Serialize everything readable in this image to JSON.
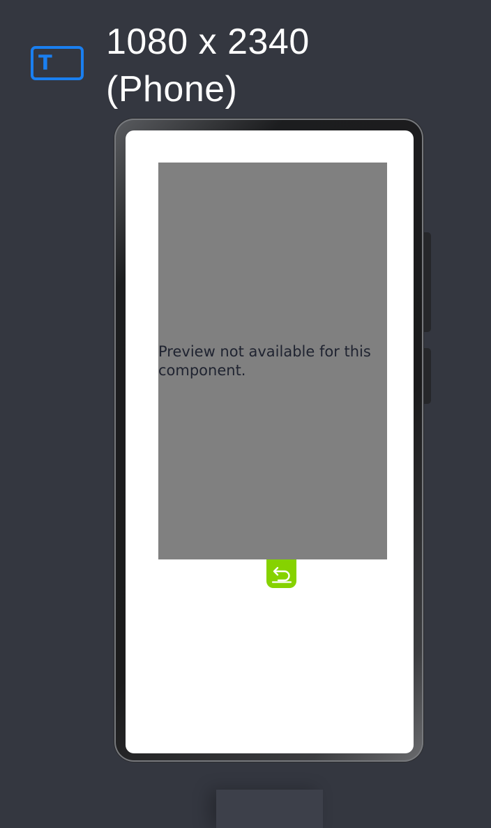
{
  "header": {
    "device_icon": "text-tablet-icon",
    "icon_glyph": "T",
    "title_line1": "1080 x 2340",
    "title_line2": "(Phone)"
  },
  "screen": {
    "preview_message": "Preview not available for this component.",
    "back_button_icon": "return-arrow-icon"
  },
  "colors": {
    "background": "#343740",
    "accent": "#1a7ff0",
    "preview_fill": "#808080",
    "back_button": "#86d200"
  }
}
